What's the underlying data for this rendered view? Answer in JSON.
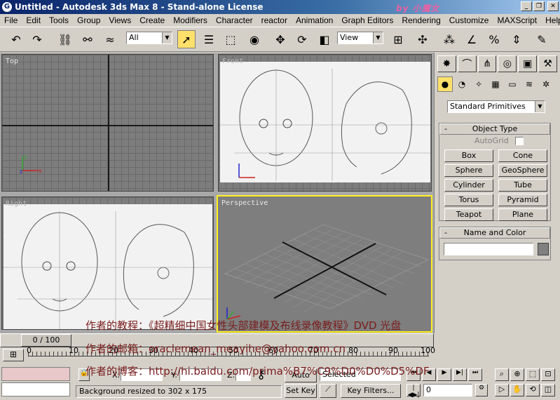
{
  "title": {
    "text": "Untitled - Autodesk 3ds Max 8 - Stand-alone License",
    "watermark": "by 小魔女"
  },
  "menu": [
    "File",
    "Edit",
    "Tools",
    "Group",
    "Views",
    "Create",
    "Modifiers",
    "Character",
    "reactor",
    "Animation",
    "Graph Editors",
    "Rendering",
    "Customize",
    "MAXScript",
    "Help"
  ],
  "toolbar": {
    "selection_filter": "All",
    "ref_coord": "View"
  },
  "viewports": {
    "top": "Top",
    "front": "Front",
    "right": "Right",
    "perspective": "Perspective"
  },
  "panel": {
    "category": "Standard Primitives",
    "object_type_title": "Object Type",
    "autogrid": "AutoGrid",
    "buttons": [
      "Box",
      "Cone",
      "Sphere",
      "GeoSphere",
      "Cylinder",
      "Tube",
      "Torus",
      "Pyramid",
      "Teapot",
      "Plane"
    ],
    "name_color_title": "Name and Color"
  },
  "time": {
    "frame_counter": "0 / 100",
    "ticks": [
      "0",
      "10",
      "20",
      "30",
      "40",
      "50",
      "60",
      "70",
      "80",
      "90",
      "100"
    ]
  },
  "status": {
    "prompt": "Background resized to 302 x 175",
    "x_label": "X:",
    "y_label": "Y:",
    "z_label": "Z:",
    "auto_key": "Auto Key",
    "set_key": "Set Key",
    "key_mode": "Selected",
    "key_filters": "Key Filters...",
    "frame": "0"
  },
  "watermark_lines": [
    "作者的教程：《超精细中国女性头部建模及布线录像教程》DVD 光盘",
    "作者的邮箱：oraclemean_meayihe@yahoo.com.cn",
    "作者的博客：http://hi.baidu.com/prima%B7%C9%D0%D0%D5%DF"
  ]
}
